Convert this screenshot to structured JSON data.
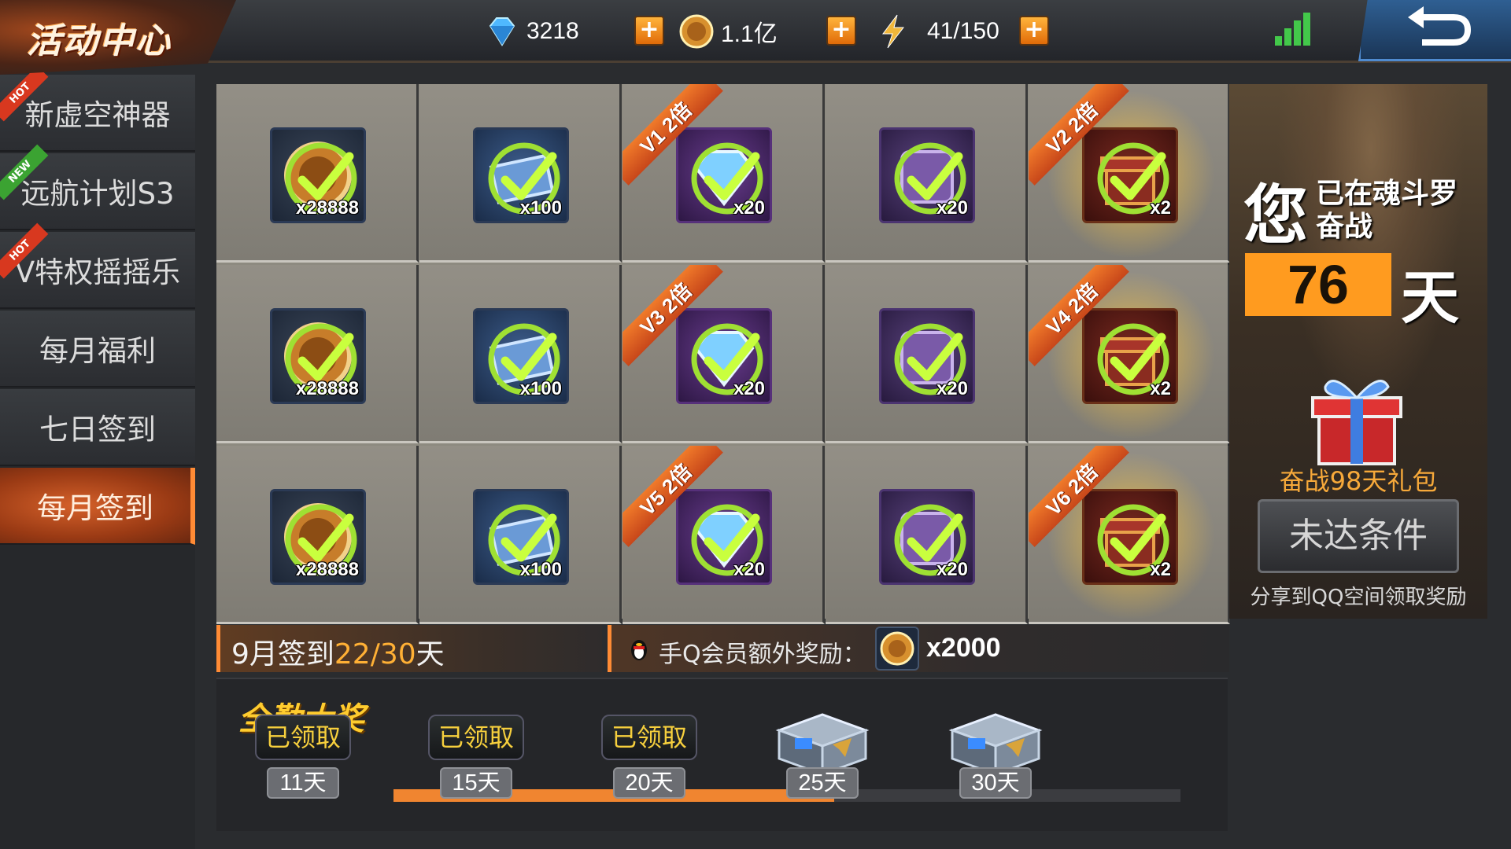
{
  "header": {
    "title": "活动中心",
    "diamonds": "3218",
    "gold": "1.1亿",
    "energy": "41/150",
    "plus_label": "+",
    "accent_color": "#ff8b35"
  },
  "sidebar": {
    "items": [
      {
        "label": "新虚空神器",
        "badge": "HOT"
      },
      {
        "label": "远航计划S3",
        "badge": "NEW"
      },
      {
        "label": "V特权摇摇乐",
        "badge": "HOT"
      },
      {
        "label": "每月福利",
        "badge": ""
      },
      {
        "label": "七日签到",
        "badge": ""
      },
      {
        "label": "每月签到",
        "badge": "",
        "active": true
      }
    ]
  },
  "grid": {
    "rows": [
      [
        {
          "type": "coin-icon",
          "qty": "x28888",
          "claimed": true
        },
        {
          "type": "book-icon",
          "qty": "x100",
          "claimed": true
        },
        {
          "type": "gem-icon",
          "qty": "x20",
          "claimed": true,
          "ribbon": "V1 2倍"
        },
        {
          "type": "exp-icon",
          "qty": "x20",
          "claimed": true
        },
        {
          "type": "gift-icon",
          "qty": "x2",
          "claimed": true,
          "ribbon": "V2 2倍",
          "glow": true
        }
      ],
      [
        {
          "type": "coin-icon",
          "qty": "x28888",
          "claimed": true
        },
        {
          "type": "book-icon",
          "qty": "x100",
          "claimed": true
        },
        {
          "type": "gem-icon",
          "qty": "x20",
          "claimed": true,
          "ribbon": "V3 2倍"
        },
        {
          "type": "exp-icon",
          "qty": "x20",
          "claimed": true
        },
        {
          "type": "gift-icon",
          "qty": "x2",
          "claimed": true,
          "ribbon": "V4 2倍",
          "glow": true
        }
      ],
      [
        {
          "type": "coin-icon",
          "qty": "x28888",
          "claimed": true
        },
        {
          "type": "book-icon",
          "qty": "x100",
          "claimed": true
        },
        {
          "type": "gem-icon",
          "qty": "x20",
          "claimed": true,
          "ribbon": "V5 2倍"
        },
        {
          "type": "exp-icon",
          "qty": "x20",
          "claimed": true
        },
        {
          "type": "gift-icon",
          "qty": "x2",
          "claimed": true,
          "ribbon": "V6 2倍",
          "glow": true
        }
      ]
    ]
  },
  "right_panel": {
    "you": "您",
    "line1": "已在魂斗罗",
    "line2": "奋战",
    "days": "76",
    "day_unit": "天",
    "gift_label": "奋战98天礼包",
    "button_label": "未达条件",
    "share_text": "分享到QQ空间领取奖励"
  },
  "signin": {
    "prefix": "9月签到",
    "progress": "22/30",
    "suffix": "天",
    "qq_label": "手Q会员额外奖励：",
    "qq_qty": "x2000"
  },
  "full_attendance": {
    "title": "全勤大奖",
    "progress_fraction": 0.56,
    "milestones": [
      {
        "day": "11天",
        "status": "已领取"
      },
      {
        "day": "15天",
        "status": "已领取"
      },
      {
        "day": "20天",
        "status": "已领取"
      },
      {
        "day": "25天",
        "status": ""
      },
      {
        "day": "30天",
        "status": ""
      }
    ]
  }
}
